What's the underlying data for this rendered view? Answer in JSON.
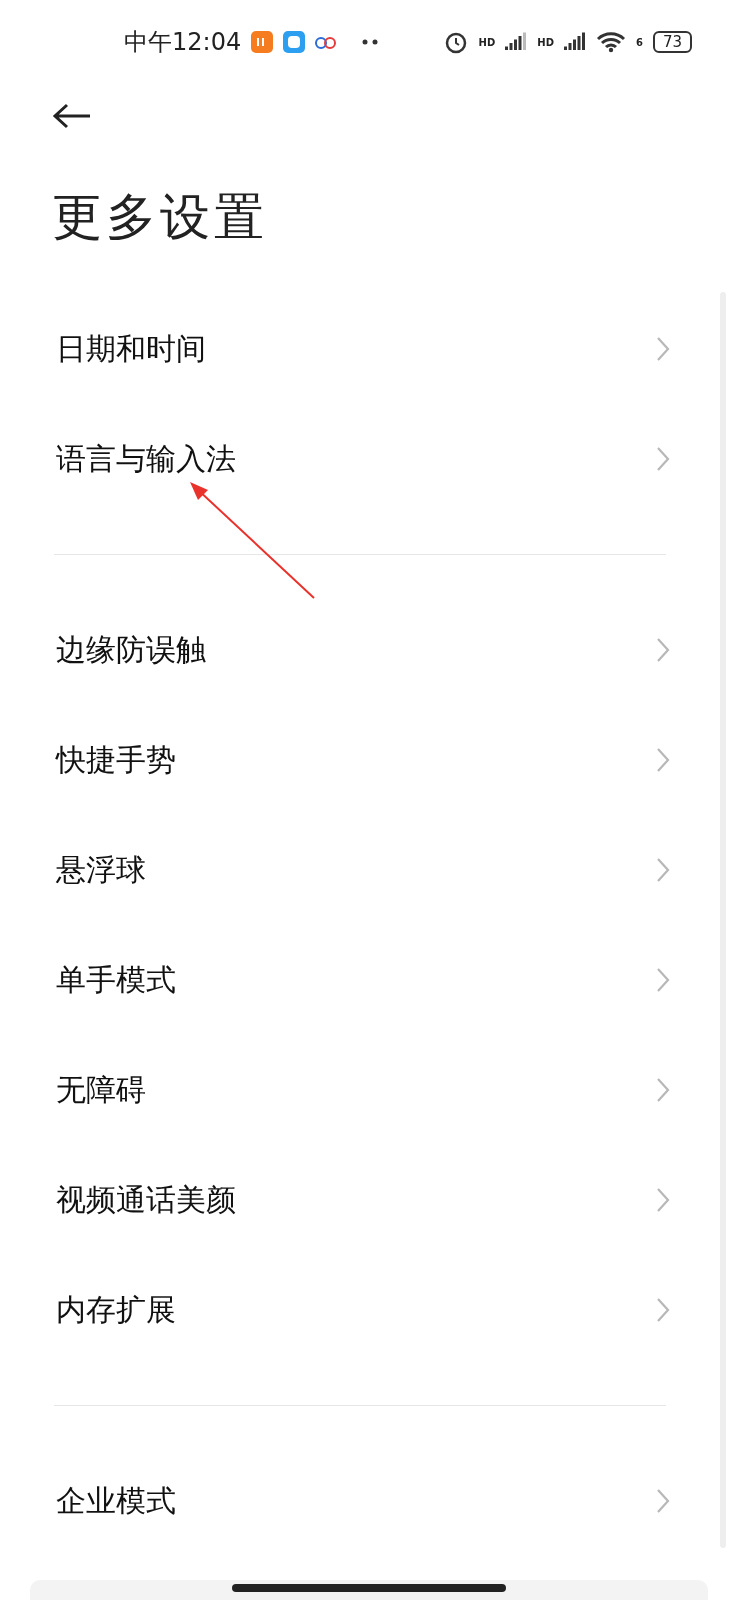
{
  "status_bar": {
    "time": "中午12:04",
    "signal_labels": [
      "HD",
      "HD"
    ],
    "wifi_label": "6",
    "battery": "73"
  },
  "title": "更多设置",
  "sections": [
    {
      "items": [
        {
          "label": "日期和时间"
        },
        {
          "label": "语言与输入法"
        }
      ]
    },
    {
      "items": [
        {
          "label": "边缘防误触"
        },
        {
          "label": "快捷手势"
        },
        {
          "label": "悬浮球"
        },
        {
          "label": "单手模式"
        },
        {
          "label": "无障碍"
        },
        {
          "label": "视频通话美颜"
        },
        {
          "label": "内存扩展"
        }
      ]
    },
    {
      "items": [
        {
          "label": "企业模式"
        }
      ]
    }
  ],
  "annotation": {
    "kind": "arrow",
    "color": "#e8322b"
  }
}
